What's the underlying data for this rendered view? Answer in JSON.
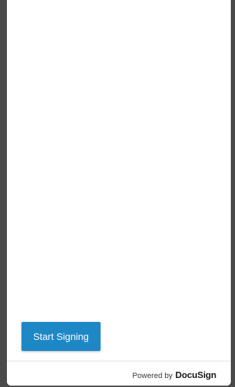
{
  "main": {
    "start_button_label": "Start Signing"
  },
  "footer": {
    "powered_by": "Powered by",
    "brand": "DocuSign"
  },
  "colors": {
    "accent": "#1e88c7",
    "frame": "#4a4a4a"
  }
}
